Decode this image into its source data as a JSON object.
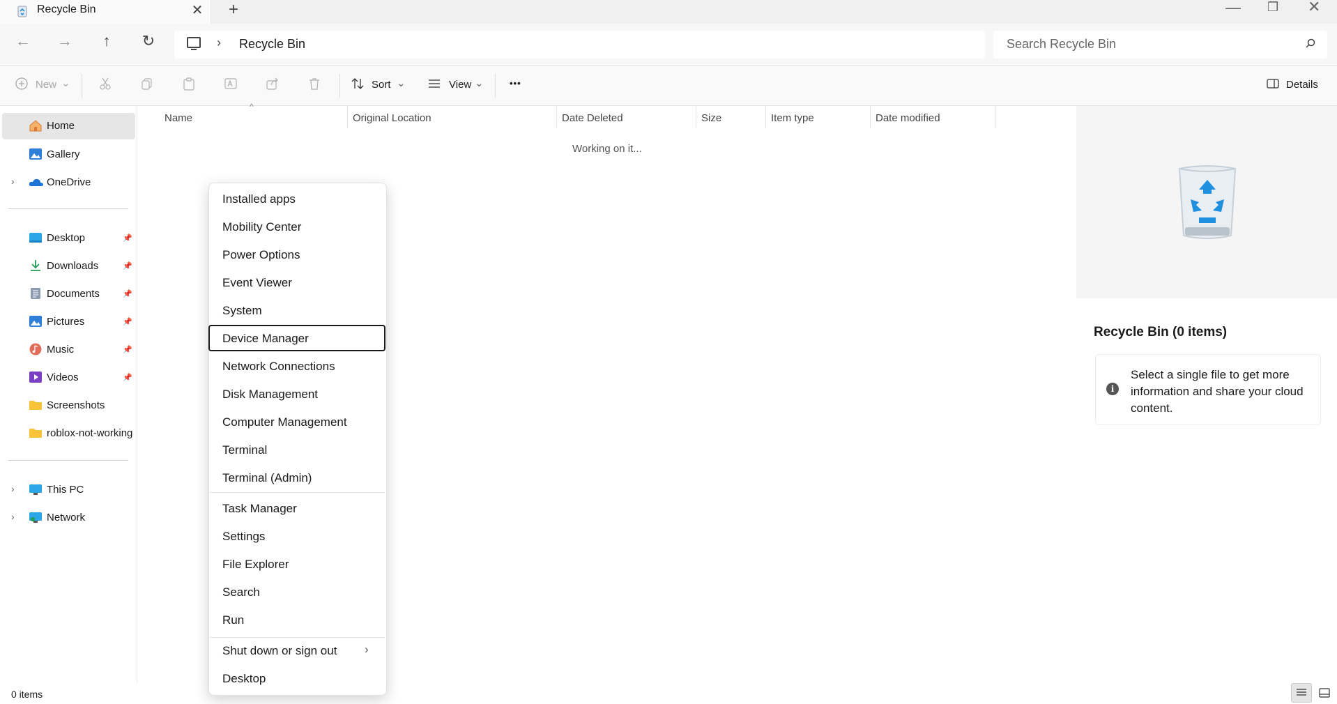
{
  "window": {
    "tab_title": "Recycle Bin",
    "new_tab": "+",
    "close_tab": "✕",
    "minimize": "—",
    "maximize": "❐",
    "close": "✕"
  },
  "nav": {
    "back": "←",
    "forward": "→",
    "up": "↑",
    "refresh": "↻",
    "breadcrumb_sep": "›",
    "breadcrumb": "Recycle Bin",
    "search_placeholder": "Search Recycle Bin"
  },
  "commands": {
    "new": "New",
    "sort": "Sort",
    "view": "View",
    "more": "•••",
    "details": "Details",
    "dropdown": "⌄"
  },
  "sidebar": {
    "home": "Home",
    "gallery": "Gallery",
    "onedrive": "OneDrive",
    "desktop": "Desktop",
    "downloads": "Downloads",
    "documents": "Documents",
    "pictures": "Pictures",
    "music": "Music",
    "videos": "Videos",
    "screenshots": "Screenshots",
    "roblox": "roblox-not-working",
    "this_pc": "This PC",
    "network": "Network",
    "chevron": "›",
    "pin": "📌"
  },
  "columns": {
    "name": "Name",
    "original_location": "Original Location",
    "date_deleted": "Date Deleted",
    "size": "Size",
    "item_type": "Item type",
    "date_modified": "Date modified",
    "sort_indicator": "^"
  },
  "content": {
    "loading": "Working on it..."
  },
  "details_pane": {
    "title": "Recycle Bin (0 items)",
    "info": "Select a single file to get more information and share your cloud content.",
    "info_icon": "i"
  },
  "status": {
    "count": "0 items"
  },
  "context_menu": {
    "items": [
      "Installed apps",
      "Mobility Center",
      "Power Options",
      "Event Viewer",
      "System",
      "Device Manager",
      "Network Connections",
      "Disk Management",
      "Computer Management",
      "Terminal",
      "Terminal (Admin)",
      "Task Manager",
      "Settings",
      "File Explorer",
      "Search",
      "Run",
      "Shut down or sign out",
      "Desktop"
    ],
    "submenu_arrow": "›",
    "focused_item": "Device Manager"
  },
  "colors": {
    "accent": "#0067c0",
    "folder": "#f8c33a",
    "onedrive": "#1e73d6",
    "recycle": "#1f8fe0"
  }
}
